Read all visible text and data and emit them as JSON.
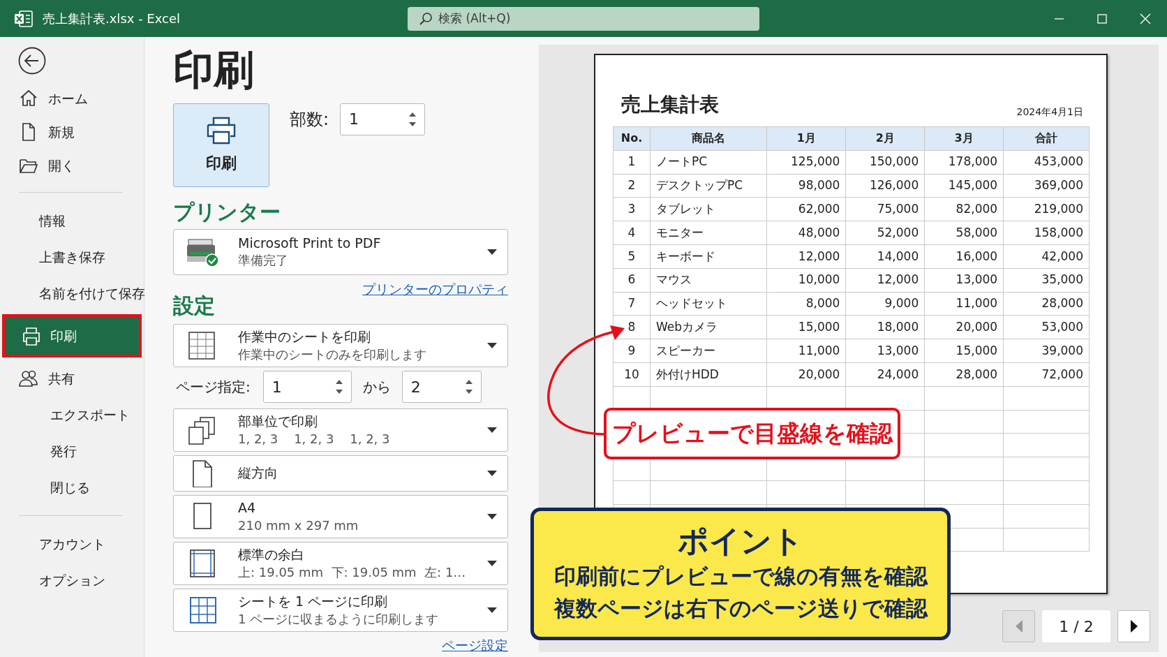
{
  "window": {
    "title": "売上集計表.xlsx  -  Excel",
    "search_placeholder": "検索 (Alt+Q)"
  },
  "sidebar": {
    "sections": [
      {
        "items": [
          {
            "label": "ホーム",
            "kind": "icon",
            "selected": false,
            "highlighted": false
          },
          {
            "label": "新規",
            "kind": "icon",
            "selected": false,
            "highlighted": false
          },
          {
            "label": "開く",
            "kind": "icon",
            "selected": false,
            "highlighted": false
          }
        ]
      },
      {
        "items": [
          {
            "label": "情報",
            "kind": "text",
            "selected": false,
            "highlighted": false
          },
          {
            "label": "上書き保存",
            "kind": "text",
            "selected": false,
            "highlighted": false
          },
          {
            "label": "名前を付けて保存",
            "kind": "text",
            "selected": false,
            "highlighted": false
          },
          {
            "label": "印刷",
            "kind": "icon",
            "selected": true,
            "highlighted": true
          },
          {
            "label": "共有",
            "kind": "icon",
            "selected": false,
            "highlighted": false
          },
          {
            "label": "エクスポート",
            "kind": "text",
            "selected": false,
            "highlighted": false
          },
          {
            "label": "発行",
            "kind": "text",
            "selected": false,
            "highlighted": false
          },
          {
            "label": "閉じる",
            "kind": "text",
            "selected": false,
            "highlighted": false
          }
        ]
      },
      {
        "items": [
          {
            "label": "アカウント",
            "kind": "text",
            "selected": false,
            "highlighted": false
          },
          {
            "label": "オプション",
            "kind": "text",
            "selected": false,
            "highlighted": false
          }
        ]
      }
    ]
  },
  "print": {
    "title": "印刷",
    "button": "印刷",
    "copies": {
      "label": "部数:",
      "value": "1"
    },
    "printer": {
      "heading": "プリンター",
      "name": "Microsoft Print to PDF",
      "status": "準備完了",
      "link": "プリンターのプロパティ"
    },
    "settings": {
      "heading": "設定",
      "items": [
        {
          "kind": "dropdown",
          "title": "作業中のシートを印刷",
          "detail": "作業中のシートのみを印刷します"
        },
        {
          "kind": "page-range",
          "label": "ページ指定:",
          "from": "1",
          "to_label": "から",
          "to": "2"
        },
        {
          "kind": "dropdown",
          "title": "部単位で印刷",
          "detail": "1, 2, 3    1, 2, 3    1, 2, 3"
        },
        {
          "kind": "dropdown",
          "title": "縦方向"
        },
        {
          "kind": "dropdown",
          "title": "A4",
          "detail": "210 mm x 297 mm"
        },
        {
          "kind": "dropdown",
          "title": "標準の余白",
          "detail": "上: 19.05 mm  下: 19.05 mm  左: 1…"
        },
        {
          "kind": "dropdown",
          "title": "シートを 1 ページに印刷",
          "detail": "1 ページに収まるように印刷します"
        }
      ],
      "link": "ページ設定"
    }
  },
  "preview": {
    "page": {
      "title": "売上集計表",
      "date": "2024年4月1日",
      "table": {
        "columns": [
          "No.",
          "商品名",
          "1月",
          "2月",
          "3月",
          "合計"
        ],
        "rows": [
          [
            "1",
            "ノートPC",
            "125,000",
            "150,000",
            "178,000",
            "453,000"
          ],
          [
            "2",
            "デスクトップPC",
            "98,000",
            "126,000",
            "145,000",
            "369,000"
          ],
          [
            "3",
            "タブレット",
            "62,000",
            "75,000",
            "82,000",
            "219,000"
          ],
          [
            "4",
            "モニター",
            "48,000",
            "52,000",
            "58,000",
            "158,000"
          ],
          [
            "5",
            "キーボード",
            "12,000",
            "14,000",
            "16,000",
            "42,000"
          ],
          [
            "6",
            "マウス",
            "10,000",
            "12,000",
            "13,000",
            "35,000"
          ],
          [
            "7",
            "ヘッドセット",
            "8,000",
            "9,000",
            "11,000",
            "28,000"
          ],
          [
            "8",
            "Webカメラ",
            "15,000",
            "18,000",
            "20,000",
            "53,000"
          ],
          [
            "9",
            "スピーカー",
            "11,000",
            "13,000",
            "15,000",
            "39,000"
          ],
          [
            "10",
            "外付けHDD",
            "20,000",
            "24,000",
            "28,000",
            "72,000"
          ]
        ]
      }
    },
    "pager": {
      "page": "1 / 2",
      "prev": {
        "disabled": true
      },
      "next": {
        "disabled": false
      }
    }
  },
  "annotations": {
    "callout": "プレビューで目盛線を確認",
    "note": {
      "title": "ポイント",
      "lines": [
        "印刷前にプレビューで線の有無を確認",
        "複数ページは右下のページ送りで確認"
      ]
    }
  }
}
